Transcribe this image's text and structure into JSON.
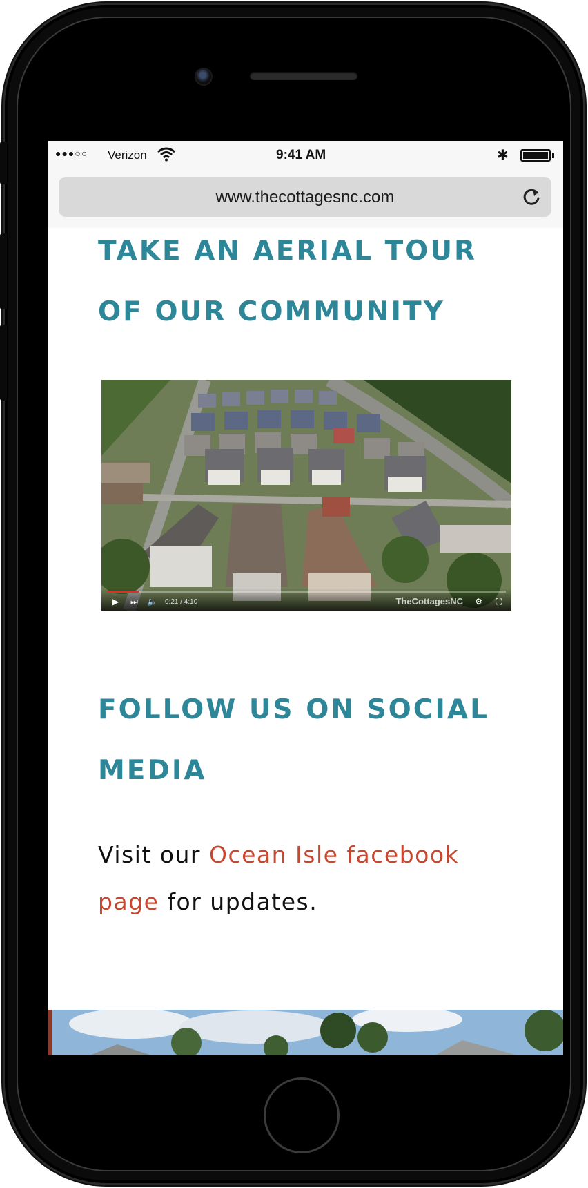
{
  "status_bar": {
    "signal": "●●●○○",
    "carrier": "Verizon",
    "time": "9:41 AM",
    "icons": [
      "wifi-icon",
      "bluetooth-icon",
      "battery-icon"
    ],
    "battery_level": 1.0
  },
  "browser": {
    "url": "www.thecottagesnc.com",
    "reload_icon": "reload-icon"
  },
  "page": {
    "aerial_heading": "TAKE AN AERIAL TOUR OF OUR COMMUNITY",
    "video": {
      "watermark": "TheCottagesNC",
      "time": "0:21 / 4:10",
      "progress": 0.08,
      "controls": [
        "play-icon",
        "next-icon",
        "volume-icon",
        "settings-icon",
        "fullscreen-icon"
      ]
    },
    "social_heading": "FOLLOW US ON SOCIAL MEDIA",
    "paragraph": {
      "prefix": "Visit our ",
      "link_text": "Ocean Isle facebook page",
      "suffix": " for updates."
    }
  },
  "colors": {
    "heading": "#2e8798",
    "link": "#c9472f",
    "text": "#111111"
  }
}
